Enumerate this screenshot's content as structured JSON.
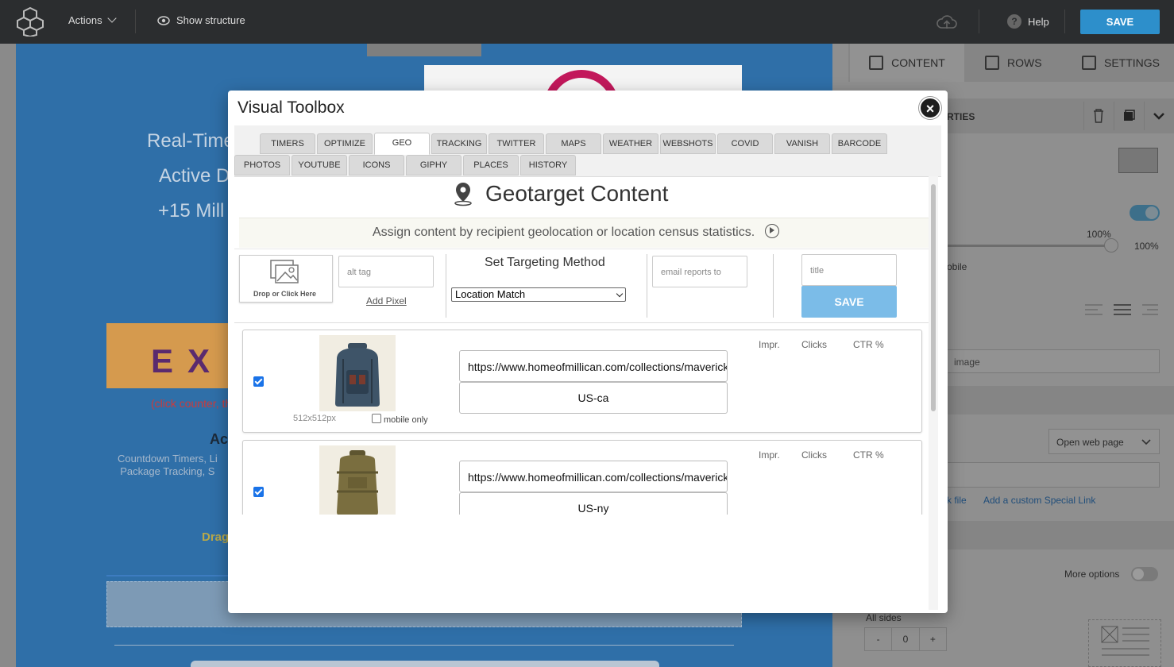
{
  "topbar": {
    "actions_label": "Actions",
    "show_structure_label": "Show structure",
    "help_label": "Help",
    "save_label": "SAVE"
  },
  "canvas": {
    "line1": "Real-Time",
    "line2": "Active D",
    "line3": "+15 Mill",
    "banner": "EX",
    "red_note": "(click counter, th",
    "heading_a": "Ac",
    "small_line1": "Countdown Timers, Li",
    "small_line2": "Package Tracking, S",
    "drag_text": "Drag"
  },
  "sidebar": {
    "tabs": [
      {
        "label": "CONTENT"
      },
      {
        "label": "ROWS"
      },
      {
        "label": "SETTINGS"
      }
    ],
    "props_label": "RTIES",
    "pct_a": "100%",
    "pct_b": "100%",
    "mobile_text": "obile",
    "image_field": "image",
    "action_select": "Open web page",
    "link_file": "k file",
    "link_custom": "Add a custom Special Link",
    "more_options": "More options",
    "all_sides": "All sides",
    "stepper_minus": "-",
    "stepper_value": "0",
    "stepper_plus": "+"
  },
  "modal": {
    "title": "Visual Toolbox",
    "close_glyph": "×",
    "tabs_row1": [
      "TIMERS",
      "OPTIMIZE",
      "GEO",
      "TRACKING",
      "TWITTER",
      "MAPS",
      "WEATHER",
      "WEBSHOTS",
      "COVID",
      "VANISH",
      "BARCODE"
    ],
    "tabs_row2": [
      "PHOTOS",
      "YOUTUBE",
      "ICONS",
      "GIPHY",
      "PLACES",
      "HISTORY"
    ],
    "active_tab": "GEO",
    "heading": "Geotarget Content",
    "assign_text": "Assign content by recipient geolocation or location census statistics.",
    "drop_label": "Drop or Click Here",
    "alt_tag_placeholder": "alt tag",
    "add_pixel": "Add Pixel",
    "set_targeting": "Set Targeting Method",
    "targeting_value": "Location Match",
    "email_reports_placeholder": "email reports to",
    "title_placeholder": "title",
    "save_label": "SAVE",
    "stats_headers": [
      "Impr.",
      "Clicks",
      "CTR %"
    ],
    "items": [
      {
        "checked": true,
        "image": "backpack-blue",
        "size": "512x512px",
        "mobile_only": "mobile only",
        "url": "https://www.homeofmillican.com/collections/maverick",
        "geo": "US-ca"
      },
      {
        "checked": true,
        "image": "backpack-olive",
        "url": "https://www.homeofmillican.com/collections/maverick",
        "geo": "US-ny"
      }
    ]
  }
}
